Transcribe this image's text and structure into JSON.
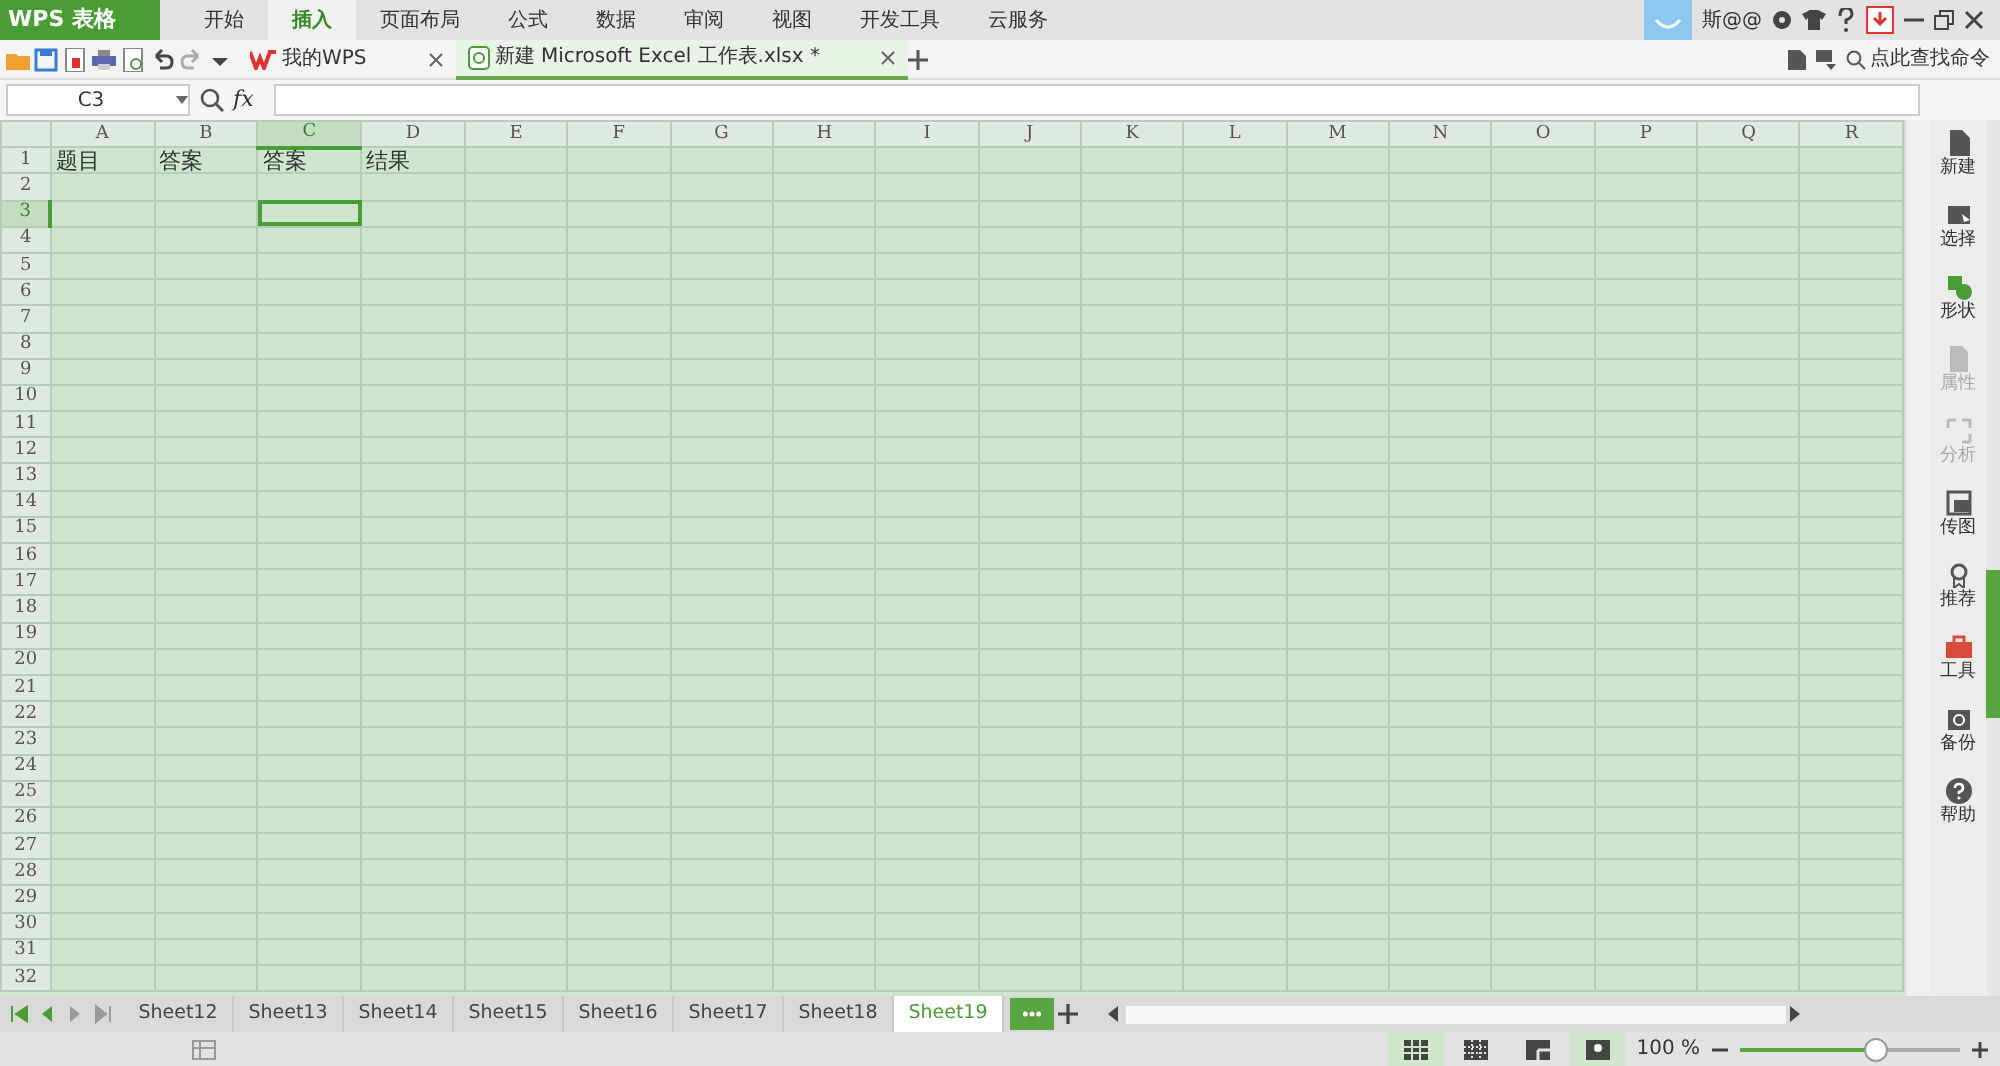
{
  "app": {
    "title": "WPS 表格"
  },
  "menu_tabs": [
    {
      "label": "开始",
      "selected": false
    },
    {
      "label": "插入",
      "selected": true
    },
    {
      "label": "页面布局",
      "selected": false
    },
    {
      "label": "公式",
      "selected": false
    },
    {
      "label": "数据",
      "selected": false
    },
    {
      "label": "审阅",
      "selected": false
    },
    {
      "label": "视图",
      "selected": false
    },
    {
      "label": "开发工具",
      "selected": false
    },
    {
      "label": "云服务",
      "selected": false
    }
  ],
  "user": {
    "name": "斯@@"
  },
  "doc_tabs": [
    {
      "label": "我的WPS",
      "selected": false,
      "kind": "home"
    },
    {
      "label": "新建 Microsoft Excel 工作表.xlsx *",
      "selected": true,
      "kind": "sheet"
    }
  ],
  "search": {
    "placeholder": "点此查找命令"
  },
  "name_box": {
    "value": "C3"
  },
  "formula": {
    "label": "fx"
  },
  "sheet": {
    "columns": [
      {
        "label": "A",
        "selected": false
      },
      {
        "label": "B",
        "selected": false
      },
      {
        "label": "C",
        "selected": true
      },
      {
        "label": "D",
        "selected": false
      },
      {
        "label": "E",
        "selected": false
      },
      {
        "label": "F",
        "selected": false
      },
      {
        "label": "G",
        "selected": false
      },
      {
        "label": "H",
        "selected": false
      },
      {
        "label": "I",
        "selected": false
      },
      {
        "label": "J",
        "selected": false
      },
      {
        "label": "K",
        "selected": false
      },
      {
        "label": "L",
        "selected": false
      },
      {
        "label": "M",
        "selected": false
      },
      {
        "label": "N",
        "selected": false
      },
      {
        "label": "O",
        "selected": false
      },
      {
        "label": "P",
        "selected": false
      },
      {
        "label": "Q",
        "selected": false
      },
      {
        "label": "R",
        "selected": false
      }
    ],
    "rows": [
      {
        "label": "1",
        "selected": false,
        "cells": [
          "题目",
          "答案",
          "答案",
          "结果"
        ]
      },
      {
        "label": "2",
        "selected": false
      },
      {
        "label": "3",
        "selected": true
      },
      {
        "label": "4",
        "selected": false
      },
      {
        "label": "5",
        "selected": false
      },
      {
        "label": "6",
        "selected": false
      },
      {
        "label": "7",
        "selected": false
      },
      {
        "label": "8",
        "selected": false
      },
      {
        "label": "9",
        "selected": false
      },
      {
        "label": "10",
        "selected": false
      },
      {
        "label": "11",
        "selected": false
      },
      {
        "label": "12",
        "selected": false
      },
      {
        "label": "13",
        "selected": false
      },
      {
        "label": "14",
        "selected": false
      },
      {
        "label": "15",
        "selected": false
      },
      {
        "label": "16",
        "selected": false
      },
      {
        "label": "17",
        "selected": false
      },
      {
        "label": "18",
        "selected": false
      },
      {
        "label": "19",
        "selected": false
      },
      {
        "label": "20",
        "selected": false
      },
      {
        "label": "21",
        "selected": false
      },
      {
        "label": "22",
        "selected": false
      },
      {
        "label": "23",
        "selected": false
      },
      {
        "label": "24",
        "selected": false
      },
      {
        "label": "25",
        "selected": false
      },
      {
        "label": "26",
        "selected": false
      },
      {
        "label": "27",
        "selected": false
      },
      {
        "label": "28",
        "selected": false
      },
      {
        "label": "29",
        "selected": false
      },
      {
        "label": "30",
        "selected": false
      },
      {
        "label": "31",
        "selected": false
      },
      {
        "label": "32",
        "selected": false
      }
    ]
  },
  "side_panel": [
    {
      "label": "新建",
      "kind": "new",
      "disabled": false
    },
    {
      "label": "选择",
      "kind": "select",
      "disabled": false
    },
    {
      "label": "形状",
      "kind": "shape",
      "disabled": false
    },
    {
      "label": "属性",
      "kind": "props",
      "disabled": true
    },
    {
      "label": "分析",
      "kind": "analyze",
      "disabled": true
    },
    {
      "label": "传图",
      "kind": "image",
      "disabled": false
    },
    {
      "label": "推荐",
      "kind": "recommend",
      "disabled": false
    },
    {
      "label": "工具",
      "kind": "tools",
      "disabled": false
    },
    {
      "label": "备份",
      "kind": "backup",
      "disabled": false
    },
    {
      "label": "帮助",
      "kind": "help",
      "disabled": false
    }
  ],
  "sheet_tabs": [
    {
      "label": "Sheet12",
      "selected": false
    },
    {
      "label": "Sheet13",
      "selected": false
    },
    {
      "label": "Sheet14",
      "selected": false
    },
    {
      "label": "Sheet15",
      "selected": false
    },
    {
      "label": "Sheet16",
      "selected": false
    },
    {
      "label": "Sheet17",
      "selected": false
    },
    {
      "label": "Sheet18",
      "selected": false
    },
    {
      "label": "Sheet19",
      "selected": true
    }
  ],
  "status": {
    "view_buttons": [
      {
        "kind": "normal",
        "selected": true
      },
      {
        "kind": "pagebreak",
        "selected": false
      },
      {
        "kind": "layout",
        "selected": false
      },
      {
        "kind": "eyecare",
        "selected": true
      }
    ],
    "zoom": "100 %",
    "zoom_slider": {
      "level": 0.62
    }
  }
}
